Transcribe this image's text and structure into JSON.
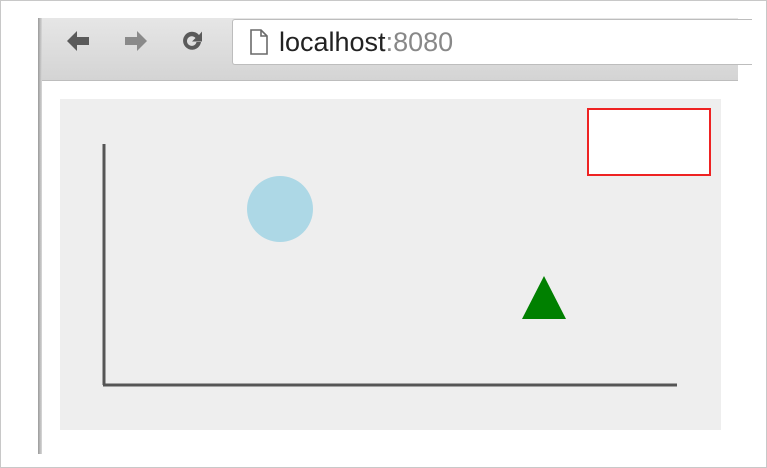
{
  "browser": {
    "address_bar": {
      "host": "localhost",
      "port": ":8080"
    },
    "icons": {
      "back": "back-arrow-icon",
      "forward": "forward-arrow-icon",
      "reload": "reload-icon",
      "page": "page-icon"
    }
  },
  "scene": {
    "background_color": "#eeeeee",
    "axes_color": "#555555",
    "circle_color": "#add8e6",
    "triangle_color": "#008000",
    "box_stroke_color": "#ee2222",
    "box_fill_color": "#ffffff"
  }
}
